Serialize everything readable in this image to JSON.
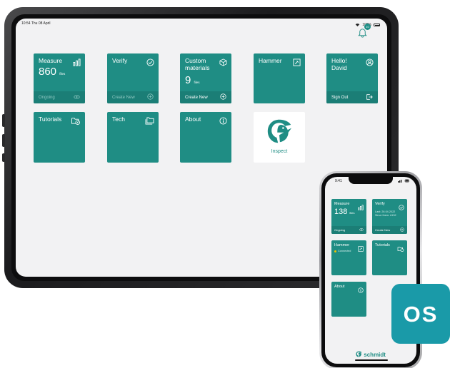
{
  "ipad": {
    "status_time": "10:54 Thu 08 April",
    "status_battery": "100%",
    "notification_count": "10",
    "tiles": [
      {
        "title": "Measure",
        "value": "860",
        "unit": "files",
        "footer": "Ongoing"
      },
      {
        "title": "Verify",
        "footer": "Create New"
      },
      {
        "title": "Custom materials",
        "value": "9",
        "unit": "files",
        "footer": "Create New"
      },
      {
        "title": "Hammer"
      },
      {
        "title": "Hello! David",
        "footer": "Sign Out"
      },
      {
        "title": "Tutorials"
      },
      {
        "title": "Tech"
      },
      {
        "title": "About"
      }
    ],
    "inspect_label": "Inspect"
  },
  "iphone": {
    "status_time": "9:41",
    "tiles": [
      {
        "title": "Measure",
        "value": "138",
        "unit": "files",
        "footer": "Ongoing"
      },
      {
        "title": "Verify",
        "line1": "Last: 26.04.2022",
        "line2": "Since them: #132",
        "footer": "Create New"
      },
      {
        "title": "Hammer",
        "status": "Connected"
      },
      {
        "title": "Tutorials"
      },
      {
        "title": "About"
      }
    ],
    "brand": "schmidt"
  },
  "badge": {
    "text": "OS"
  },
  "colors": {
    "tile": "#1f8d84",
    "tile_footer": "#1b7e76",
    "badge": "#1a9aa8",
    "accent_dot": "#f2c200"
  }
}
